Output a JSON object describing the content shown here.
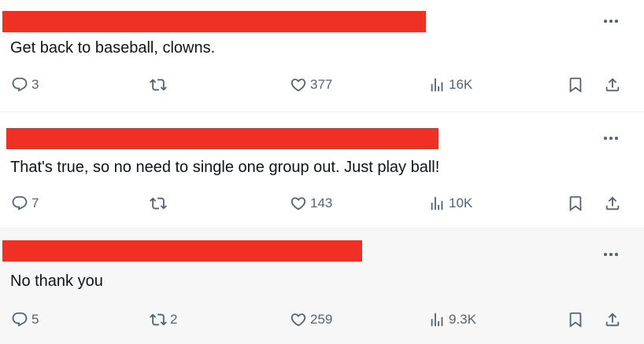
{
  "replies": [
    {
      "text": "Get back to baseball, clowns.",
      "replies": "3",
      "reposts": "",
      "likes": "377",
      "views": "16K"
    },
    {
      "text": "That's true, so no need to single one group out. Just play ball!",
      "replies": "7",
      "reposts": "",
      "likes": "143",
      "views": "10K"
    },
    {
      "text": "No thank you",
      "replies": "5",
      "reposts": "2",
      "likes": "259",
      "views": "9.3K"
    }
  ],
  "colors": {
    "redaction": "#ee3124",
    "icon": "#536471",
    "text": "#0f1419",
    "highlight_bg": "#f7f7f7"
  },
  "icons": [
    "reply-icon",
    "repost-icon",
    "like-icon",
    "views-icon",
    "bookmark-icon",
    "share-icon",
    "more-icon"
  ]
}
